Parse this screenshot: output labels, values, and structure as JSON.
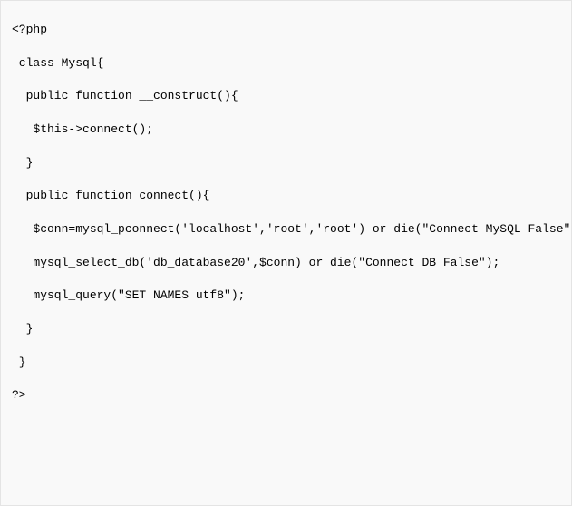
{
  "code": {
    "line1": "<?php",
    "line2": " class Mysql{",
    "line3": "  public function __construct(){",
    "line4": "   $this->connect();",
    "line5": "  }",
    "line6": "  public function connect(){",
    "line7": "   $conn=mysql_pconnect('localhost','root','root') or die(\"Connect MySQL False\");",
    "line8": "   mysql_select_db('db_database20',$conn) or die(\"Connect DB False\");",
    "line9": "   mysql_query(\"SET NAMES utf8\");",
    "line10": "  }",
    "line11": " }",
    "line12": "?>"
  }
}
